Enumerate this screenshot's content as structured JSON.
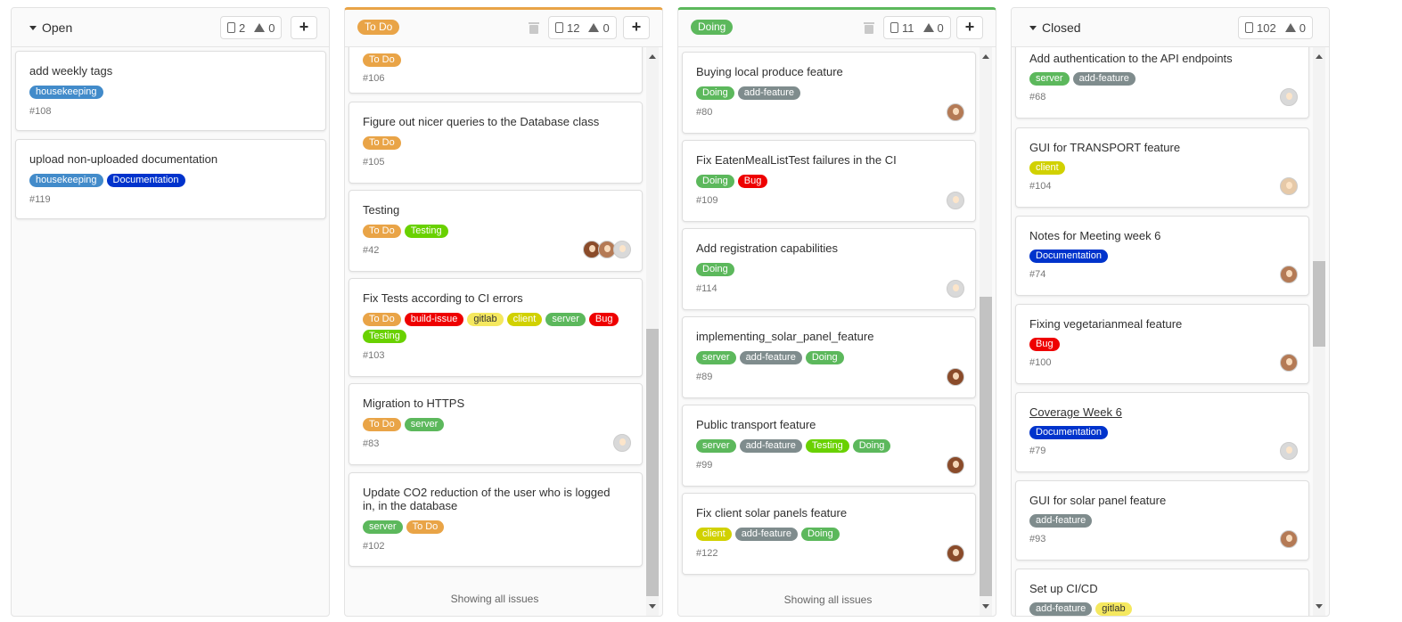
{
  "colors": {
    "todo": "#e9a447",
    "doing": "#5cb85c",
    "housekeeping": "#428bca",
    "documentation": "#0033cc",
    "build_issue": "#d9534f",
    "gitlab": "#f5e85f",
    "client": "#d1d100",
    "server": "#5cb85c",
    "bug": "#ee0000",
    "testing": "#69d100",
    "add_feature": "#7f8c8d"
  },
  "columns": [
    {
      "title": "Open",
      "issue_count": "2",
      "weight_count": "0",
      "cards": [
        {
          "title": "add weekly tags",
          "labels": [
            "housekeeping"
          ],
          "ref": "#108"
        },
        {
          "title": "upload non-uploaded documentation",
          "labels": [
            "housekeeping",
            "Documentation"
          ],
          "ref": "#119"
        }
      ]
    },
    {
      "title": "To Do",
      "issue_count": "12",
      "weight_count": "0",
      "footer": "Showing all issues",
      "cards": [
        {
          "title": "",
          "labels": [
            "To Do"
          ],
          "ref": "#106"
        },
        {
          "title": "Figure out nicer queries to the Database class",
          "labels": [
            "To Do"
          ],
          "ref": "#105"
        },
        {
          "title": "Testing",
          "labels": [
            "To Do",
            "Testing"
          ],
          "ref": "#42"
        },
        {
          "title": "Fix Tests according to CI errors",
          "labels": [
            "To Do",
            "build-issue",
            "gitlab",
            "client",
            "server",
            "Bug",
            "Testing"
          ],
          "ref": "#103"
        },
        {
          "title": "Migration to HTTPS",
          "labels": [
            "To Do",
            "server"
          ],
          "ref": "#83"
        },
        {
          "title": "Update CO2 reduction of the user who is logged in, in the database",
          "labels": [
            "server",
            "To Do"
          ],
          "ref": "#102"
        }
      ]
    },
    {
      "title": "Doing",
      "issue_count": "11",
      "weight_count": "0",
      "footer": "Showing all issues",
      "cards": [
        {
          "title": "Buying local produce feature",
          "labels": [
            "Doing",
            "add-feature"
          ],
          "ref": "#80"
        },
        {
          "title": "Fix EatenMealListTest failures in the CI",
          "labels": [
            "Doing",
            "Bug"
          ],
          "ref": "#109"
        },
        {
          "title": "Add registration capabilities",
          "labels": [
            "Doing"
          ],
          "ref": "#114"
        },
        {
          "title": "implementing_solar_panel_feature",
          "labels": [
            "server",
            "add-feature",
            "Doing"
          ],
          "ref": "#89"
        },
        {
          "title": "Public transport feature",
          "labels": [
            "server",
            "add-feature",
            "Testing",
            "Doing"
          ],
          "ref": "#99"
        },
        {
          "title": "Fix client solar panels feature",
          "labels": [
            "client",
            "add-feature",
            "Doing"
          ],
          "ref": "#122"
        }
      ]
    },
    {
      "title": "Closed",
      "issue_count": "102",
      "weight_count": "0",
      "cards": [
        {
          "title": "Add authentication to the API endpoints",
          "labels": [
            "server",
            "add-feature"
          ],
          "ref": "#68"
        },
        {
          "title": "GUI for TRANSPORT feature",
          "labels": [
            "client"
          ],
          "ref": "#104"
        },
        {
          "title": "Notes for Meeting week 6",
          "labels": [
            "Documentation"
          ],
          "ref": "#74"
        },
        {
          "title": "Fixing vegetarianmeal feature",
          "labels": [
            "Bug"
          ],
          "ref": "#100"
        },
        {
          "title": "Coverage Week 6",
          "labels": [
            "Documentation"
          ],
          "ref": "#79"
        },
        {
          "title": "GUI for solar panel feature",
          "labels": [
            "add-feature"
          ],
          "ref": "#93"
        },
        {
          "title": "Set up CI/CD",
          "labels": [
            "add-feature",
            "gitlab"
          ],
          "ref": ""
        }
      ]
    }
  ]
}
